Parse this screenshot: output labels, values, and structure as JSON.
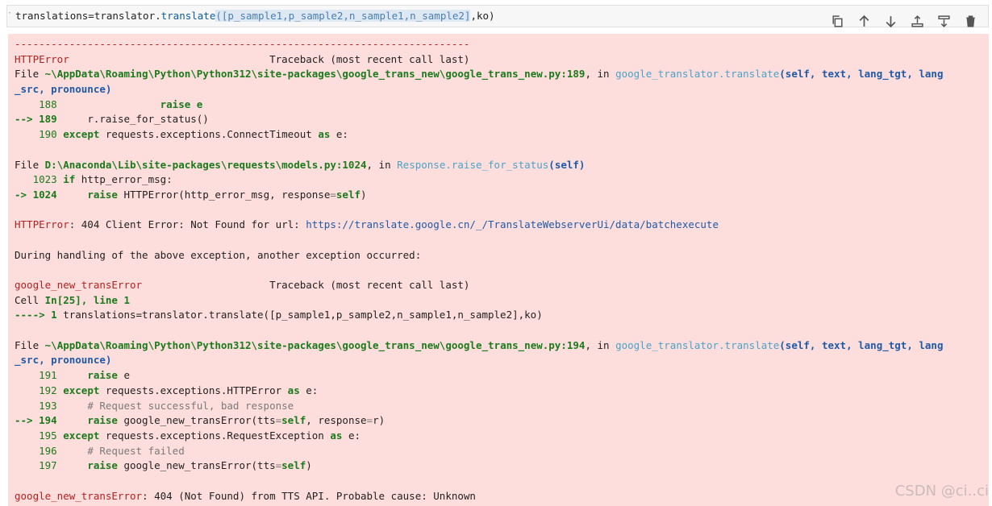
{
  "input_cell": {
    "code_prefix": "translations=translator.",
    "code_call": "translate",
    "code_open": "(",
    "code_list": "[p_sample1,p_sample2,n_sample1,n_sample2]",
    "code_rest": ",ko)"
  },
  "toolbar": {
    "buttons": [
      {
        "name": "copy-icon"
      },
      {
        "name": "arrow-up-icon"
      },
      {
        "name": "arrow-down-icon"
      },
      {
        "name": "insert-above-icon"
      },
      {
        "name": "insert-below-icon"
      },
      {
        "name": "trash-icon"
      }
    ]
  },
  "output": {
    "sep": "---------------------------------------------------------------------------",
    "err1_name": "HTTPError",
    "err1_tb": "                                 Traceback (most recent call last)",
    "f1_file": "~\\AppData\\Roaming\\Python\\Python312\\site-packages\\google_trans_new\\google_trans_new.py:189",
    "f1_in": ", in ",
    "f1_func": "google_translator.translate",
    "f1_args": "(self, text, lang_tgt, lang",
    "f1_args2": "_src, pronounce)",
    "f1_l188_no": "    188",
    "f1_l188": "                 raise e",
    "f1_l189_arrow": "--> 189",
    "f1_l189": "     r.raise_for_status()",
    "f1_l190_no": "    190",
    "f1_l190_kw": " except",
    "f1_l190_a": " requests.exceptions.ConnectTimeout ",
    "f1_l190_as": "as",
    "f1_l190_b": " e:",
    "f2_file": "D:\\Anaconda\\Lib\\site-packages\\requests\\models.py:1024",
    "f2_in": ", in ",
    "f2_func": "Response.raise_for_status",
    "f2_args": "(self)",
    "f2_l1023_no": "   1023",
    "f2_l1023_kw": " if",
    "f2_l1023": " http_error_msg:",
    "f2_l1024_arrow": "-> 1024",
    "f2_l1024_kw": "     raise",
    "f2_l1024_a": " HTTPError(http_error_msg, response",
    "f2_l1024_eq": "=",
    "f2_l1024_self": "self",
    "f2_l1024_b": ")",
    "err1_msg_name": "HTTPError",
    "err1_msg": ": 404 Client Error: Not Found for url: ",
    "err1_url": "https://translate.google.cn/_/TranslateWebserverUi/data/batchexecute",
    "during": "During handling of the above exception, another exception occurred:",
    "err2_name": "google_new_transError",
    "err2_tb": "                     Traceback (most recent call last)",
    "cell_label": "Cell ",
    "cell_ref": "In[25], line 1",
    "cell_arrow": "----> 1",
    "cell_code": " translations=translator.translate([p_sample1,p_sample2,n_sample1,n_sample2],ko)",
    "f3_file": "~\\AppData\\Roaming\\Python\\Python312\\site-packages\\google_trans_new\\google_trans_new.py:194",
    "f3_in": ", in ",
    "f3_func": "google_translator.translate",
    "f3_args": "(self, text, lang_tgt, lang",
    "f3_args2": "_src, pronounce)",
    "f3_l191_no": "    191",
    "f3_l191_kw": "     raise",
    "f3_l191": " e",
    "f3_l192_no": "    192",
    "f3_l192_kw": " except",
    "f3_l192_a": " requests.exceptions.HTTPError ",
    "f3_l192_as": "as",
    "f3_l192_b": " e:",
    "f3_l193_no": "    193",
    "f3_l193": "     # Request successful, bad response",
    "f3_l194_arrow": "--> 194",
    "f3_l194_kw": "     raise",
    "f3_l194_a": " google_new_transError(tts",
    "f3_l194_eq": "=",
    "f3_l194_self": "self",
    "f3_l194_b": ", response",
    "f3_l194_eq2": "=",
    "f3_l194_c": "r)",
    "f3_l195_no": "    195",
    "f3_l195_kw": " except",
    "f3_l195_a": " requests.exceptions.RequestException ",
    "f3_l195_as": "as",
    "f3_l195_b": " e:",
    "f3_l196_no": "    196",
    "f3_l196": "     # Request failed",
    "f3_l197_no": "    197",
    "f3_l197_kw": "     raise",
    "f3_l197_a": " google_new_transError(tts",
    "f3_l197_eq": "=",
    "f3_l197_self": "self",
    "f3_l197_b": ")",
    "err2_msg_name": "google_new_transError",
    "err2_msg": ": 404 (Not Found) from TTS API. Probable cause: Unknown"
  },
  "watermark": "CSDN @ci..ci",
  "colors": {
    "error_bg": "#fddedc",
    "error_red": "#b22222",
    "kw_green": "#1b7a1b",
    "link_blue": "#1e5aa8",
    "func_cyan": "#4aa3c7"
  }
}
